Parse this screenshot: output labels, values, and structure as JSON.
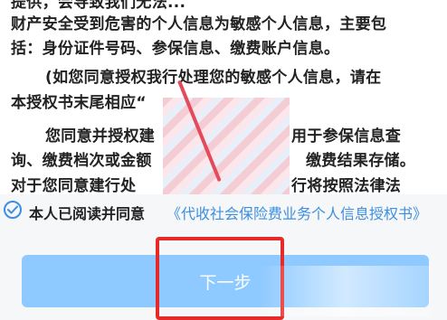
{
  "document": {
    "line0": "提供，会导致我们无法...",
    "line1": "财产安全受到危害的个人信息为敏感个人信息，主要包",
    "line2": "括：身份证件号码、参保信息、缴费账户信息。",
    "line3": "(如您同意授权我行处理您的敏感个人信息，请在",
    "line4": "本授权书末尾相应“",
    "line5": "您同意并授权建",
    "line5b": "用于参保信息查",
    "line6": "询、缴费档次或金额",
    "line6b": "缴费结果存储。",
    "line7": "对于您同意建行处",
    "line7b": "行将按照法律法"
  },
  "consent": {
    "text": "本人已阅读并同意",
    "link": "《代收社会保险费业务个人信息授权书》"
  },
  "next_button": {
    "label": "下一步"
  },
  "colors": {
    "accent": "#3b8fe0",
    "button": "#8ec9ff",
    "highlight": "#e62a2a"
  },
  "icons": {
    "consent_check": "check-circle-icon"
  }
}
